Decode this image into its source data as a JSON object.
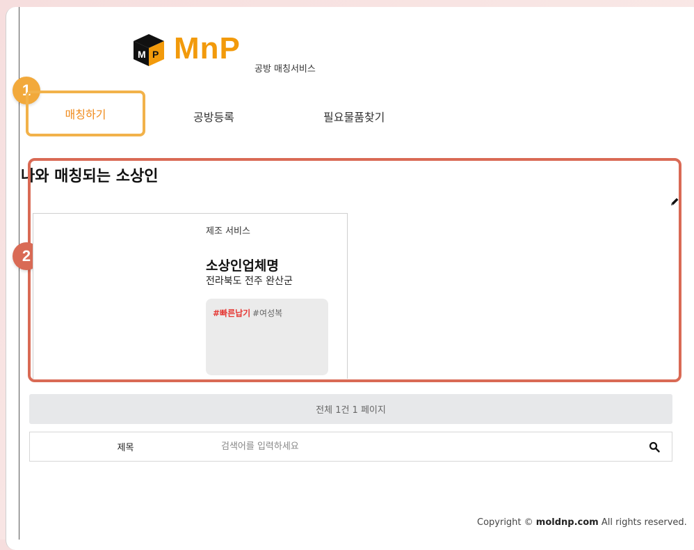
{
  "logo": {
    "text": "MnP",
    "subtitle": "공방 매칭서비스"
  },
  "badges": {
    "one": "1",
    "two": "2"
  },
  "nav": {
    "items": [
      "매칭하기",
      "공방등록",
      "필요물품찾기"
    ]
  },
  "section": {
    "title": "나와 매칭되는 소상인"
  },
  "card": {
    "category": "제조 서비스",
    "name": "소상인업체명",
    "location": "전라북도 전주 완산군",
    "tags": [
      "#빠른납기",
      "#여성복"
    ]
  },
  "pager": {
    "text": "전체 1건 1 페이지"
  },
  "search": {
    "field_label": "제목",
    "placeholder": "검색어를 입력하세요"
  },
  "footer": {
    "prefix": "Copyright ©",
    "domain": "moldnp.com",
    "suffix": "All rights reserved."
  },
  "colors": {
    "brand": "#f29a0b",
    "highlight": "#d96a55",
    "badge1": "#f2a93b",
    "tag_primary": "#e53935"
  }
}
